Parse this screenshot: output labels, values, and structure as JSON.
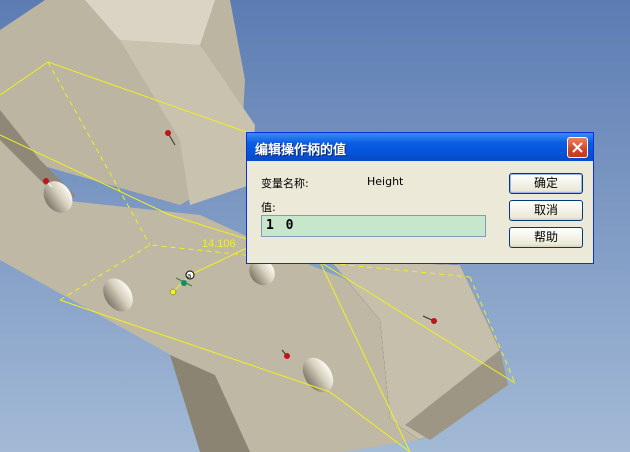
{
  "viewport": {
    "dimension_label": "14.106",
    "handle_label": "a"
  },
  "dialog": {
    "title": "编辑操作柄的值",
    "variable_name_label": "变量名称:",
    "variable_name_value": "Height",
    "value_label": "值:",
    "value_input": "1 0",
    "buttons": {
      "ok": "确定",
      "cancel": "取消",
      "help": "帮助"
    }
  },
  "colors": {
    "background_top": "#5f7fb5",
    "background_bottom": "#9fb7d4",
    "part_face": "#bdb6a2",
    "part_face_light": "#cbc5b3",
    "wireframe": "#f0f020",
    "input_fill": "#c8e6cc",
    "title_bar": "#0a5ee2"
  }
}
